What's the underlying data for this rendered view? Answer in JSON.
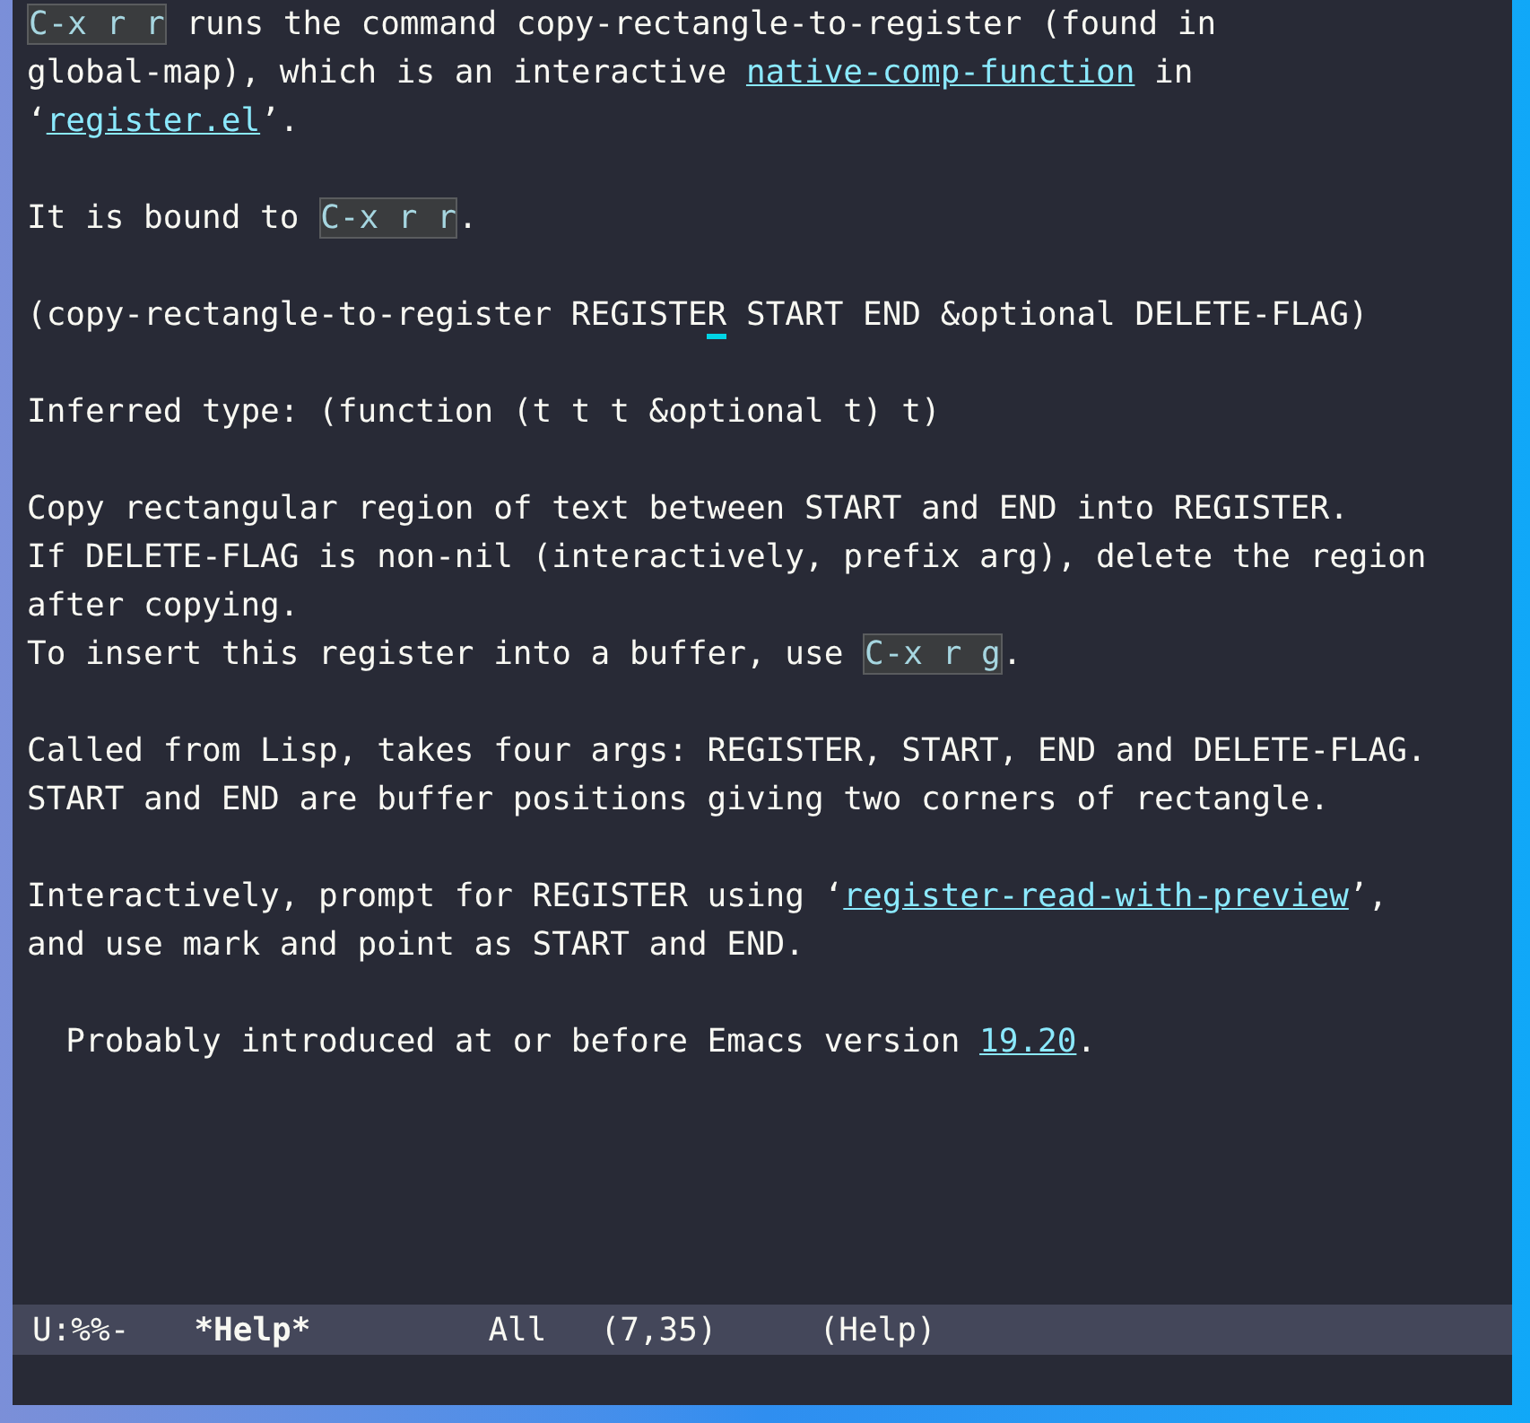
{
  "paragraphs": [
    {
      "lines": [
        [
          {
            "kind": "key",
            "text": "C-x r r"
          },
          {
            "kind": "text",
            "text": " runs the command copy-rectangle-to-register (found in"
          }
        ],
        [
          {
            "kind": "text",
            "text": "global-map), which is an interactive "
          },
          {
            "kind": "link",
            "text": "native-comp-function"
          },
          {
            "kind": "text",
            "text": " in"
          }
        ],
        [
          {
            "kind": "text",
            "text": "‘"
          },
          {
            "kind": "link",
            "text": "register.el"
          },
          {
            "kind": "text",
            "text": "’."
          }
        ]
      ]
    },
    {
      "lines": [
        [
          {
            "kind": "text",
            "text": "It is bound to "
          },
          {
            "kind": "key",
            "text": "C-x r r"
          },
          {
            "kind": "text",
            "text": "."
          }
        ]
      ]
    },
    {
      "lines": [
        [
          {
            "kind": "text",
            "text": "(copy-rectangle-to-register REGISTE"
          },
          {
            "kind": "cursor",
            "text": "R"
          },
          {
            "kind": "text",
            "text": " START END &optional DELETE-FLAG)"
          }
        ]
      ]
    },
    {
      "lines": [
        [
          {
            "kind": "text",
            "text": "Inferred type: (function (t t t &optional t) t)"
          }
        ]
      ]
    },
    {
      "lines": [
        [
          {
            "kind": "text",
            "text": "Copy rectangular region of text between START and END into REGISTER."
          }
        ],
        [
          {
            "kind": "text",
            "text": "If DELETE-FLAG is non-nil (interactively, prefix arg), delete the region"
          }
        ],
        [
          {
            "kind": "text",
            "text": "after copying."
          }
        ],
        [
          {
            "kind": "text",
            "text": "To insert this register into a buffer, use "
          },
          {
            "kind": "key",
            "text": "C-x r g"
          },
          {
            "kind": "text",
            "text": "."
          }
        ]
      ]
    },
    {
      "lines": [
        [
          {
            "kind": "text",
            "text": "Called from Lisp, takes four args: REGISTER, START, END and DELETE-FLAG."
          }
        ],
        [
          {
            "kind": "text",
            "text": "START and END are buffer positions giving two corners of rectangle."
          }
        ]
      ]
    },
    {
      "lines": [
        [
          {
            "kind": "text",
            "text": "Interactively, prompt for REGISTER using ‘"
          },
          {
            "kind": "link",
            "text": "register-read-with-preview"
          },
          {
            "kind": "text",
            "text": "’,"
          }
        ],
        [
          {
            "kind": "text",
            "text": "and use mark and point as START and END."
          }
        ]
      ]
    },
    {
      "lines": [
        [
          {
            "kind": "text",
            "text": "  Probably introduced at or before Emacs version "
          },
          {
            "kind": "link",
            "text": "19.20"
          },
          {
            "kind": "text",
            "text": "."
          }
        ]
      ]
    }
  ],
  "mode_line": {
    "status": "U:%%-",
    "buffer_name": "*Help*",
    "position": "All",
    "line_column": "(7,35)",
    "mode": "(Help)"
  }
}
